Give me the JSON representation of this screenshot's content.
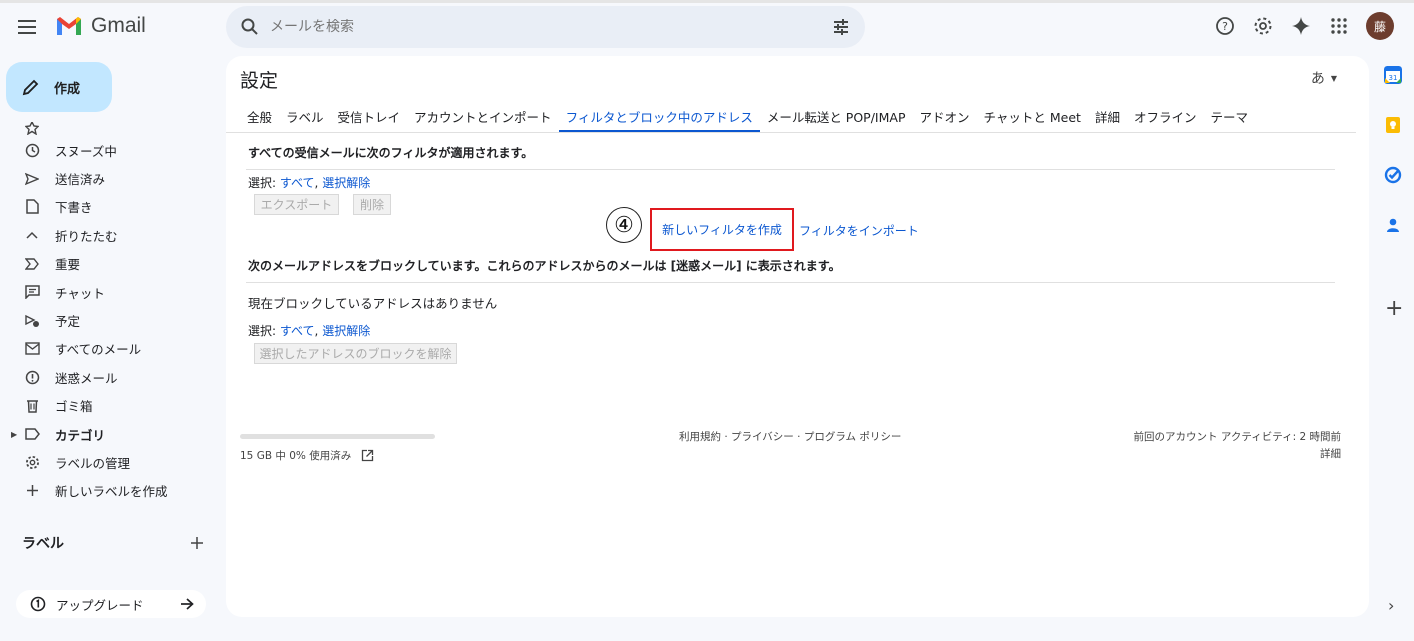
{
  "app": {
    "name": "Gmail",
    "search_placeholder": "メールを検索",
    "avatar_initial": "藤"
  },
  "compose": {
    "label": "作成"
  },
  "sidebar": {
    "items": [
      {
        "label": "",
        "icon": "star-icon"
      },
      {
        "label": "スヌーズ中",
        "icon": "clock-icon"
      },
      {
        "label": "送信済み",
        "icon": "send-icon"
      },
      {
        "label": "下書き",
        "icon": "draft-icon"
      },
      {
        "label": "折りたたむ",
        "icon": "chevron-up-icon"
      },
      {
        "label": "重要",
        "icon": "important-icon"
      },
      {
        "label": "チャット",
        "icon": "chat-icon"
      },
      {
        "label": "予定",
        "icon": "scheduled-icon"
      },
      {
        "label": "すべてのメール",
        "icon": "all-mail-icon"
      },
      {
        "label": "迷惑メール",
        "icon": "spam-icon"
      },
      {
        "label": "ゴミ箱",
        "icon": "trash-icon"
      },
      {
        "label": "カテゴリ",
        "icon": "label-icon"
      },
      {
        "label": "ラベルの管理",
        "icon": "gear-icon"
      },
      {
        "label": "新しいラベルを作成",
        "icon": "plus-icon"
      }
    ],
    "labels_title": "ラベル",
    "upgrade_label": "アップグレード"
  },
  "settings": {
    "title": "設定",
    "ime_indicator": "あ",
    "tabs": [
      "全般",
      "ラベル",
      "受信トレイ",
      "アカウントとインポート",
      "フィルタとブロック中のアドレス",
      "メール転送と POP/IMAP",
      "アドオン",
      "チャットと Meet",
      "詳細",
      "オフライン",
      "テーマ"
    ],
    "filters_section_title": "すべての受信メールに次のフィルタが適用されます。",
    "select_label": "選択: ",
    "select_all": "すべて",
    "comma": ", ",
    "select_none": "選択解除",
    "export_button": "エクスポート",
    "delete_button": "削除",
    "annotation_marker": "④",
    "create_filter": "新しいフィルタを作成",
    "import_filter": "フィルタをインポート",
    "blocked_section_title": "次のメールアドレスをブロックしています。これらのアドレスからのメールは [迷惑メール] に表示されます。",
    "no_blocked": "現在ブロックしているアドレスはありません",
    "unblock_button": "選択したアドレスのブロックを解除"
  },
  "footer": {
    "storage": "15 GB 中 0% 使用済み",
    "storage_used_fraction": 0.0,
    "policies": "利用規約 · プライバシー · プログラム ポリシー",
    "last_activity": "前回のアカウント アクティビティ: 2 時間前",
    "details": "詳細"
  },
  "colors": {
    "accent": "#0b57d0",
    "compose_bg": "#c2e7ff",
    "highlight_box": "#e0191e",
    "avatar_bg": "#6d3d2e"
  }
}
